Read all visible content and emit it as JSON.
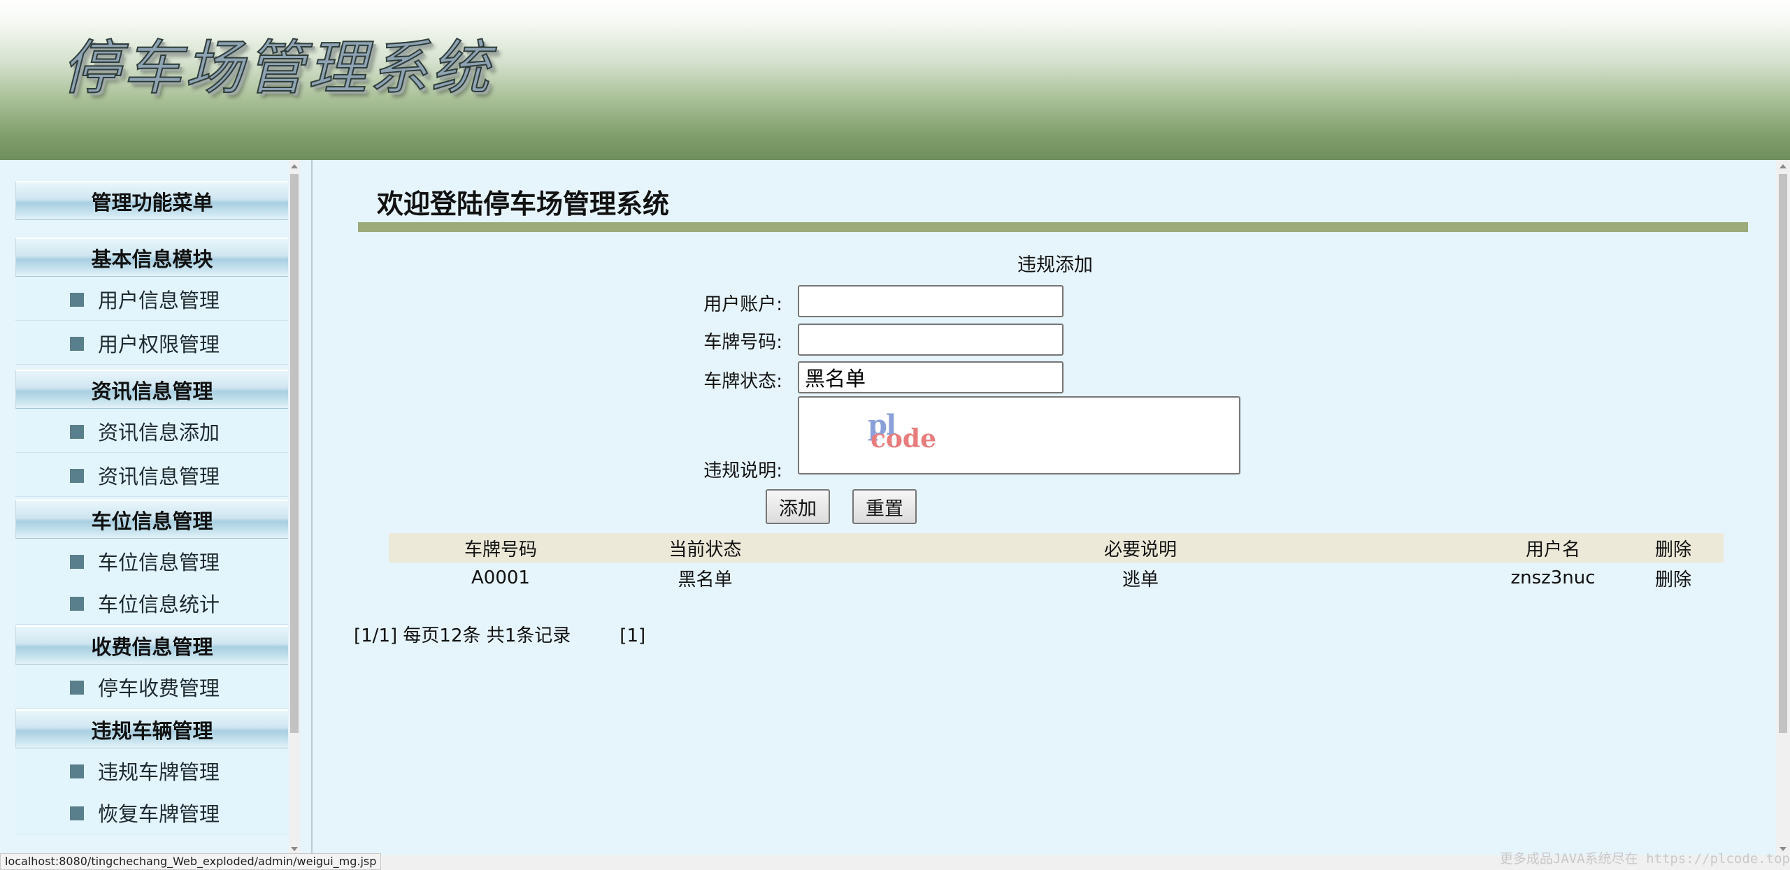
{
  "header": {
    "title": "停车场管理系统"
  },
  "sidebar": {
    "menu_title": "管理功能菜单",
    "sections": [
      {
        "title": "基本信息模块",
        "items": [
          "用户信息管理",
          "用户权限管理"
        ]
      },
      {
        "title": "资讯信息管理",
        "items": [
          "资讯信息添加",
          "资讯信息管理"
        ]
      },
      {
        "title": "车位信息管理",
        "items": [
          "车位信息管理",
          "车位信息统计"
        ]
      },
      {
        "title": "收费信息管理",
        "items": [
          "停车收费管理"
        ]
      },
      {
        "title": "违规车辆管理",
        "items": [
          "违规车牌管理",
          "恢复车牌管理"
        ]
      }
    ]
  },
  "main": {
    "welcome": "欢迎登陆停车场管理系统",
    "form": {
      "title": "违规添加",
      "user_account_label": "用户账户:",
      "user_account_value": "",
      "plate_label": "车牌号码:",
      "plate_value": "",
      "plate_status_label": "车牌状态:",
      "plate_status_value": "黑名单",
      "description_label": "违规说明:",
      "description_value": "",
      "add_button": "添加",
      "reset_button": "重置"
    },
    "table": {
      "columns": [
        "车牌号码",
        "当前状态",
        "必要说明",
        "用户名",
        "删除"
      ],
      "rows": [
        [
          "A0001",
          "黑名单",
          "逃单",
          "znsz3nuc",
          "删除"
        ]
      ]
    },
    "pager": {
      "summary": "[1/1] 每页12条 共1条记录",
      "page_link": "[1]"
    }
  },
  "watermark": {
    "line1": "pl",
    "line2": "code"
  },
  "status_bar": {
    "url": "localhost:8080/tingchechang_Web_exploded/admin/weigui_mg.jsp"
  },
  "bottom_note": "更多成品JAVA系统尽在 https://plcode.top"
}
